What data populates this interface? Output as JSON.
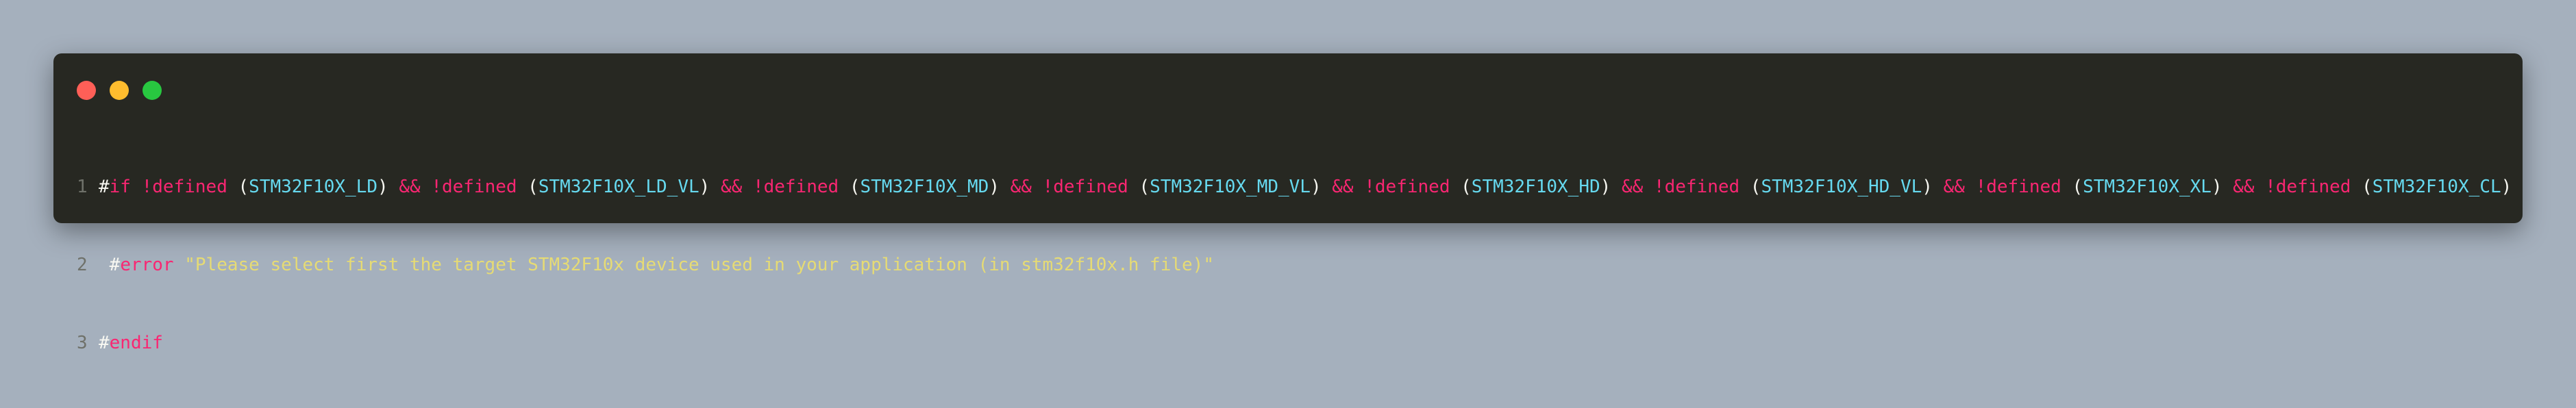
{
  "window": {
    "controls": [
      {
        "name": "close",
        "color": "#ff5f57"
      },
      {
        "name": "minimize",
        "color": "#febc2e"
      },
      {
        "name": "zoom",
        "color": "#28c840"
      }
    ]
  },
  "code": {
    "lines": [
      {
        "number": "1",
        "tokens": [
          {
            "text": "#",
            "kind": "punc"
          },
          {
            "text": "if",
            "kind": "kw"
          },
          {
            "text": " ",
            "kind": "punc"
          },
          {
            "text": "!defined",
            "kind": "kw"
          },
          {
            "text": " (",
            "kind": "punc"
          },
          {
            "text": "STM32F10X_LD",
            "kind": "macro"
          },
          {
            "text": ") ",
            "kind": "punc"
          },
          {
            "text": "&&",
            "kind": "kw"
          },
          {
            "text": " ",
            "kind": "punc"
          },
          {
            "text": "!defined",
            "kind": "kw"
          },
          {
            "text": " (",
            "kind": "punc"
          },
          {
            "text": "STM32F10X_LD_VL",
            "kind": "macro"
          },
          {
            "text": ") ",
            "kind": "punc"
          },
          {
            "text": "&&",
            "kind": "kw"
          },
          {
            "text": " ",
            "kind": "punc"
          },
          {
            "text": "!defined",
            "kind": "kw"
          },
          {
            "text": " (",
            "kind": "punc"
          },
          {
            "text": "STM32F10X_MD",
            "kind": "macro"
          },
          {
            "text": ") ",
            "kind": "punc"
          },
          {
            "text": "&&",
            "kind": "kw"
          },
          {
            "text": " ",
            "kind": "punc"
          },
          {
            "text": "!defined",
            "kind": "kw"
          },
          {
            "text": " (",
            "kind": "punc"
          },
          {
            "text": "STM32F10X_MD_VL",
            "kind": "macro"
          },
          {
            "text": ") ",
            "kind": "punc"
          },
          {
            "text": "&&",
            "kind": "kw"
          },
          {
            "text": " ",
            "kind": "punc"
          },
          {
            "text": "!defined",
            "kind": "kw"
          },
          {
            "text": " (",
            "kind": "punc"
          },
          {
            "text": "STM32F10X_HD",
            "kind": "macro"
          },
          {
            "text": ") ",
            "kind": "punc"
          },
          {
            "text": "&&",
            "kind": "kw"
          },
          {
            "text": " ",
            "kind": "punc"
          },
          {
            "text": "!defined",
            "kind": "kw"
          },
          {
            "text": " (",
            "kind": "punc"
          },
          {
            "text": "STM32F10X_HD_VL",
            "kind": "macro"
          },
          {
            "text": ") ",
            "kind": "punc"
          },
          {
            "text": "&&",
            "kind": "kw"
          },
          {
            "text": " ",
            "kind": "punc"
          },
          {
            "text": "!defined",
            "kind": "kw"
          },
          {
            "text": " (",
            "kind": "punc"
          },
          {
            "text": "STM32F10X_XL",
            "kind": "macro"
          },
          {
            "text": ") ",
            "kind": "punc"
          },
          {
            "text": "&&",
            "kind": "kw"
          },
          {
            "text": " ",
            "kind": "punc"
          },
          {
            "text": "!defined",
            "kind": "kw"
          },
          {
            "text": " (",
            "kind": "punc"
          },
          {
            "text": "STM32F10X_CL",
            "kind": "macro"
          },
          {
            "text": ")",
            "kind": "punc"
          }
        ]
      },
      {
        "number": "2",
        "tokens": [
          {
            "text": " #",
            "kind": "punc"
          },
          {
            "text": "error",
            "kind": "kw"
          },
          {
            "text": " ",
            "kind": "punc"
          },
          {
            "text": "\"Please select first the target STM32F10x device used in your application (in stm32f10x.h file)\"",
            "kind": "str"
          }
        ]
      },
      {
        "number": "3",
        "tokens": [
          {
            "text": "#",
            "kind": "punc"
          },
          {
            "text": "endif",
            "kind": "kw"
          }
        ]
      }
    ]
  }
}
